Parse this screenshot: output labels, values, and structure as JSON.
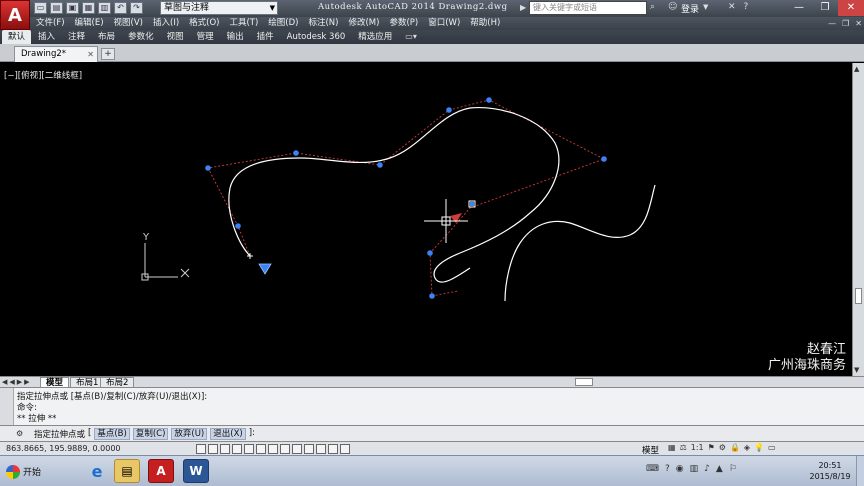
{
  "titlebar": {
    "workspace": "草图与注释",
    "title": "Autodesk AutoCAD 2014    Drawing2.dwg",
    "search_placeholder": "键入关键字或短语",
    "login": "登录"
  },
  "menu": {
    "items": [
      "文件(F)",
      "编辑(E)",
      "视图(V)",
      "插入(I)",
      "格式(O)",
      "工具(T)",
      "绘图(D)",
      "标注(N)",
      "修改(M)",
      "参数(P)",
      "窗口(W)",
      "帮助(H)"
    ]
  },
  "ribbon": {
    "tabs": [
      "默认",
      "插入",
      "注释",
      "布局",
      "参数化",
      "视图",
      "管理",
      "输出",
      "插件",
      "Autodesk 360",
      "精选应用"
    ],
    "active": "默认"
  },
  "document": {
    "tab": "Drawing2*",
    "new_tab": "+"
  },
  "canvas": {
    "viewport_label": "[−][俯视][二维线框]",
    "ucs_x": "X",
    "ucs_y": "Y",
    "watermark_line1": "赵春江",
    "watermark_line2": "广州海珠商务"
  },
  "layout": {
    "tabs": [
      "模型",
      "布局1",
      "布局2"
    ],
    "active": "模型"
  },
  "command": {
    "history": [
      "指定拉伸点或  [基点(B)/复制(C)/放弃(U)/退出(X)]:",
      "命令:",
      "** 拉伸 **"
    ],
    "prompt": "指定拉伸点或",
    "options": [
      "基点(B)",
      "复制(C)",
      "放弃(U)",
      "退出(X)"
    ],
    "suffix": "]:"
  },
  "status": {
    "coords": "863.8665,  195.9889,  0.0000",
    "model": "模型",
    "scale": "1:1"
  },
  "taskbar": {
    "start": "开始",
    "time": "20:51",
    "date": "2015/8/19"
  },
  "colors": {
    "curve": "#ffffff",
    "control_frame": "#d23b3b",
    "grip": "#3b82f6",
    "canvas": "#000000"
  }
}
